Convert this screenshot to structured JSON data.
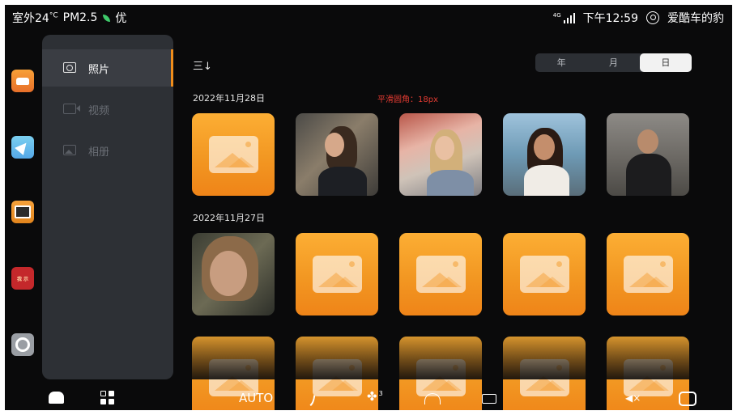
{
  "status_bar": {
    "outdoor_temp": "室外24",
    "temp_unit": "°C",
    "pm25_label": "PM2.5",
    "air_quality": "优",
    "network": "4G",
    "time": "下午12:59",
    "user_name": "爱酷车的豹"
  },
  "dock": {
    "apps": [
      "car-app-icon",
      "navigation-app-icon",
      "photo-app-icon",
      "red-app-icon",
      "settings-app-icon"
    ],
    "red_app_text": "我 示"
  },
  "sidebar": {
    "items": [
      {
        "label": "照片",
        "icon": "camera-icon",
        "active": true
      },
      {
        "label": "视频",
        "icon": "video-icon",
        "active": false
      },
      {
        "label": "相册",
        "icon": "album-icon",
        "active": false
      }
    ],
    "accent_color": "#f08d1b"
  },
  "main": {
    "sort_icon_text": "三↓",
    "view_tabs": [
      {
        "label": "年",
        "active": false
      },
      {
        "label": "月",
        "active": false
      },
      {
        "label": "日",
        "active": true
      }
    ],
    "annotation": "平滑圆角：18px",
    "groups": [
      {
        "date": "2022年11月28日",
        "items": [
          "placeholder",
          "photo",
          "photo",
          "photo",
          "photo"
        ]
      },
      {
        "date": "2022年11月27日",
        "items": [
          "photo",
          "placeholder",
          "placeholder",
          "placeholder",
          "placeholder"
        ]
      },
      {
        "date": "",
        "items": [
          "placeholder",
          "placeholder",
          "placeholder",
          "placeholder",
          "placeholder"
        ]
      }
    ],
    "placeholder_color": "#f29722"
  },
  "bottom_bar": {
    "ac_mode": "AUTO",
    "fan_level": "3",
    "icons": [
      "home-icon",
      "apps-grid-icon",
      "seat-airflow-icon",
      "fan-icon",
      "front-defrost-icon",
      "rear-defrost-icon",
      "volume-mute-icon",
      "camera-icon"
    ]
  }
}
